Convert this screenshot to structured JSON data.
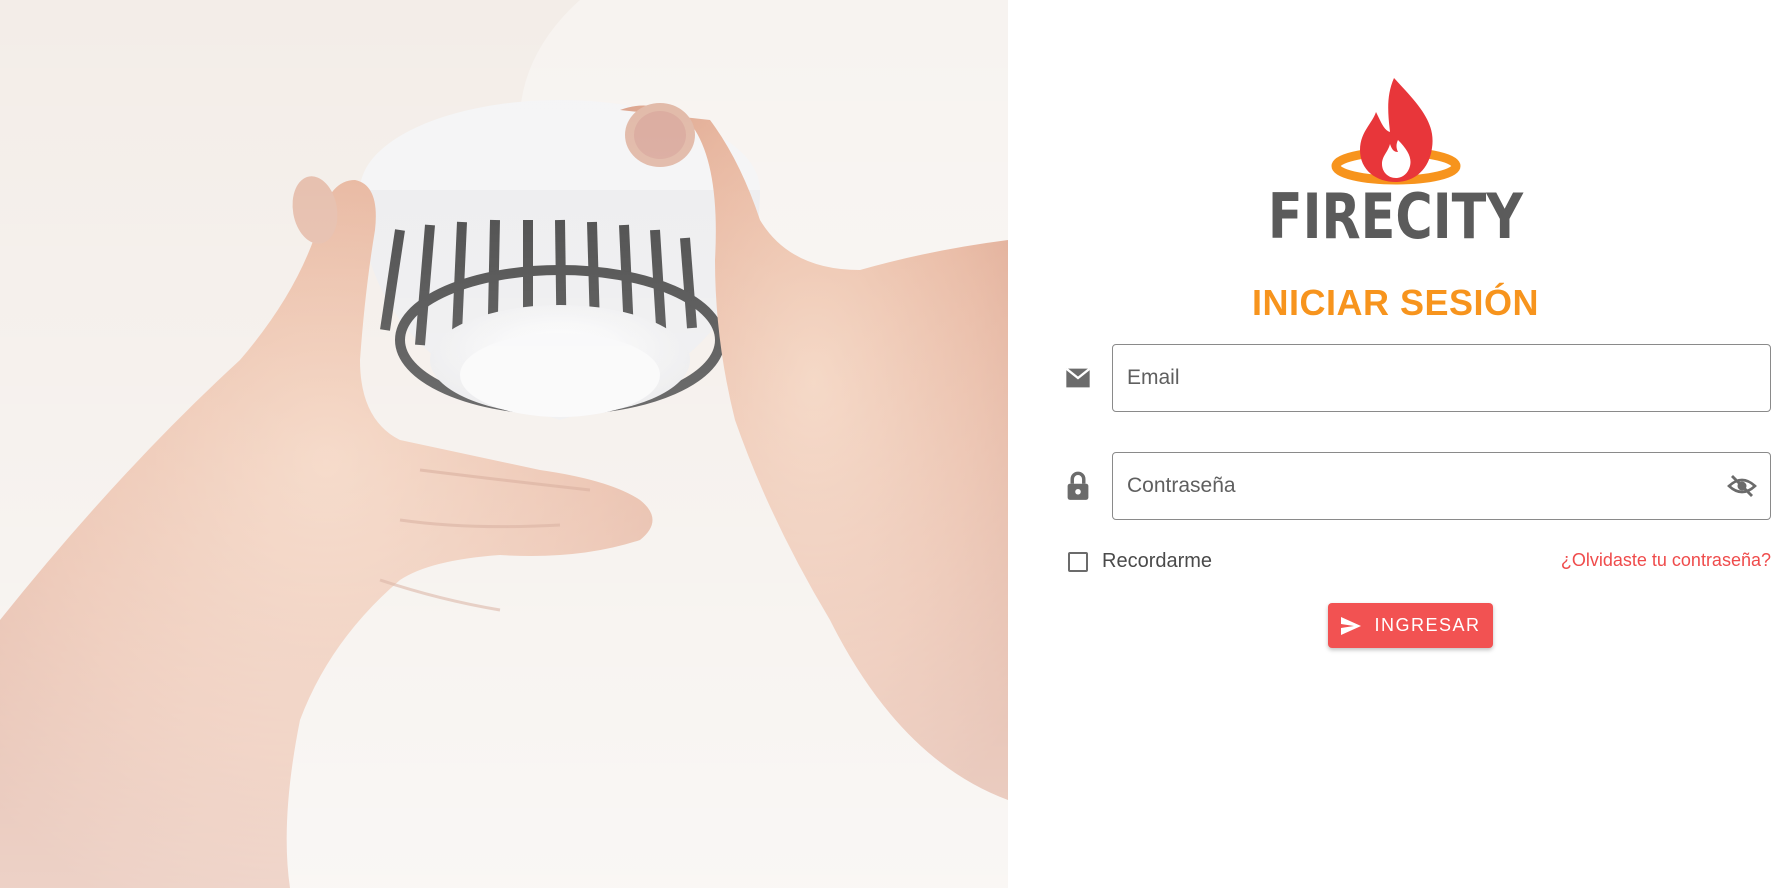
{
  "brand": {
    "name": "FIRECITY",
    "colors": {
      "flame_red": "#e8363a",
      "flame_orange": "#f7941d",
      "text_gray": "#5b5b5b",
      "accent_red": "#f25252"
    }
  },
  "hero": {
    "image_subject": "hands installing smoke detector",
    "icon": "smoke-detector"
  },
  "login": {
    "title": "INICIAR SESIÓN",
    "email": {
      "placeholder": "Email",
      "value": "",
      "icon": "email-icon"
    },
    "password": {
      "placeholder": "Contraseña",
      "value": "",
      "icon": "lock-icon",
      "toggle_icon": "visibility-off-icon"
    },
    "remember_label": "Recordarme",
    "remember_checked": false,
    "forgot_label": "¿Olvidaste tu contraseña?",
    "submit_label": "INGRESAR",
    "submit_icon": "send-icon"
  }
}
